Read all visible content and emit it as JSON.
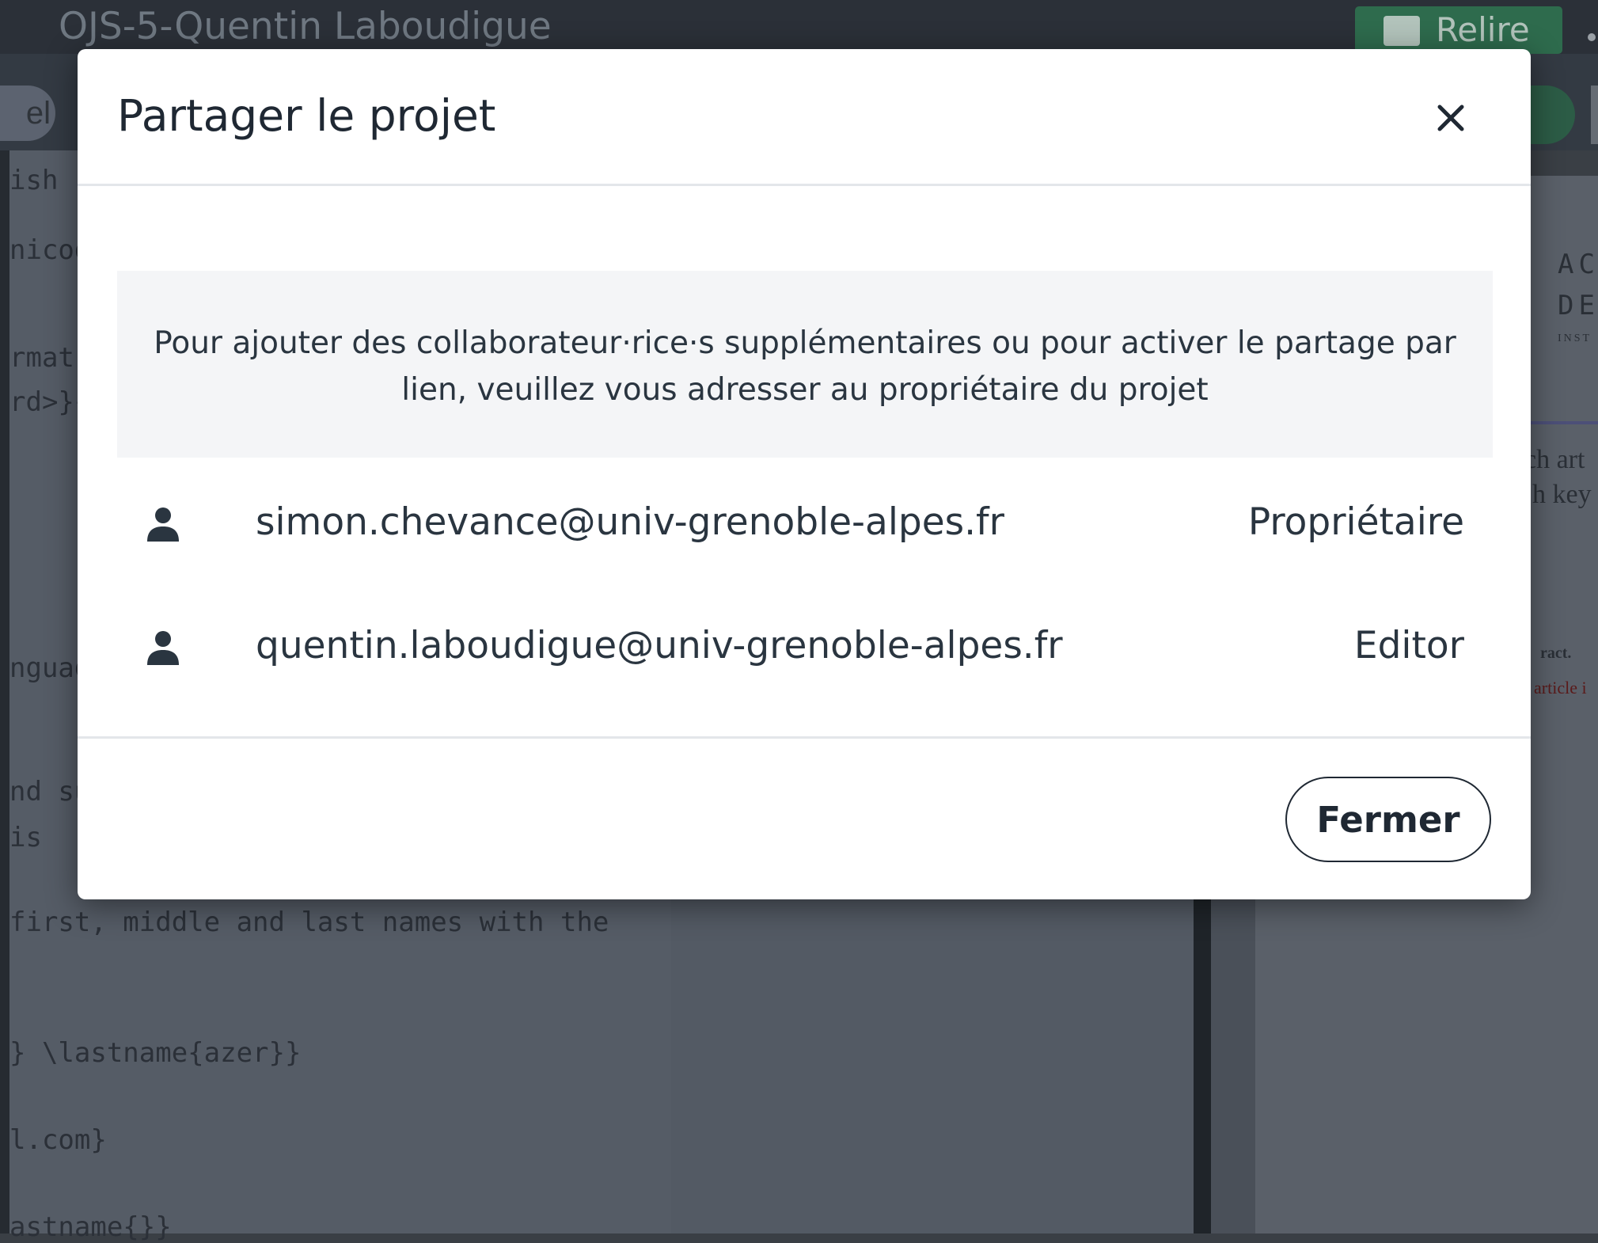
{
  "app": {
    "project_title": "OJS-5-Quentin Laboudigue",
    "review_button_label": "Relire",
    "toolbar_left_pill_text": "el"
  },
  "editor_lines": [
    "ish",
    "nicod",
    "rmat",
    "rd>}{",
    "nguag",
    "nd su",
    "  is",
    "first, middle and last names with the",
    "} \\lastname{azer}}",
    "l.com}",
    "astname{}}"
  ],
  "preview": {
    "line1": "ACA",
    "line2": "DES",
    "line3": "INST",
    "line4": "ch art",
    "line5": "h key",
    "line6": "ract.",
    "line7": "article i"
  },
  "modal": {
    "title": "Partager le projet",
    "close_icon_name": "close-icon",
    "info_text": "Pour ajouter des collaborateur·rice·s supplémentaires ou pour activer le partage par lien, veuillez vous adresser au propriétaire du projet",
    "members": [
      {
        "email": "simon.chevance@univ-grenoble-alpes.fr",
        "role": "Propriétaire",
        "icon": "user-icon"
      },
      {
        "email": "quentin.laboudigue@univ-grenoble-alpes.fr",
        "role": "Editor",
        "icon": "user-icon"
      }
    ],
    "footer_button_label": "Fermer"
  },
  "colors": {
    "overlay_background": "#3a3f45",
    "modal_background": "#ffffff",
    "info_box_background": "#f4f5f7",
    "text_primary": "#1f2833",
    "review_button_green": "#2e6b4d"
  }
}
